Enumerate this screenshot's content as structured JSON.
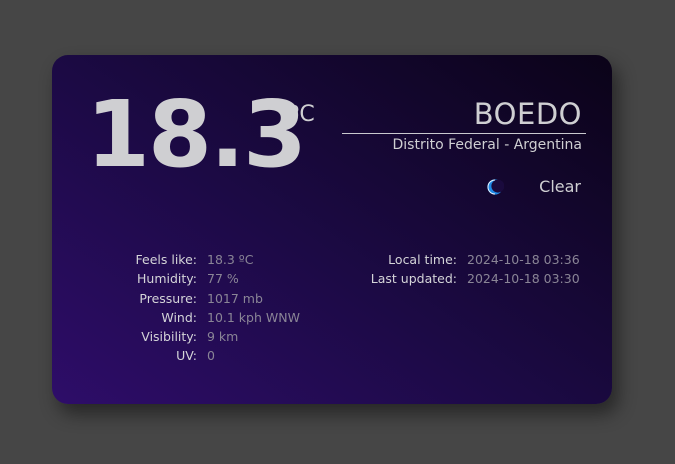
{
  "current": {
    "temperature": "18.3",
    "unit": "ºC",
    "condition": "Clear",
    "condition_icon": "moon-icon"
  },
  "location": {
    "city": "BOEDO",
    "region": "Distrito Federal - Argentina"
  },
  "details": [
    {
      "label": "Feels like:",
      "value": "18.3 ºC"
    },
    {
      "label": "Humidity:",
      "value": "77 %"
    },
    {
      "label": "Pressure:",
      "value": "1017 mb"
    },
    {
      "label": "Wind:",
      "value": "10.1 kph WNW"
    },
    {
      "label": "Visibility:",
      "value": "9 km"
    },
    {
      "label": "UV:",
      "value": "0"
    }
  ],
  "times": [
    {
      "label": "Local time:",
      "value": "2024-10-18 03:36"
    },
    {
      "label": "Last updated:",
      "value": "2024-10-18 03:30"
    }
  ],
  "colors": {
    "background": "#464646",
    "card_gradient_start": "#2e0d69",
    "card_gradient_end": "#0b0318",
    "moon": "#1e88e5"
  }
}
